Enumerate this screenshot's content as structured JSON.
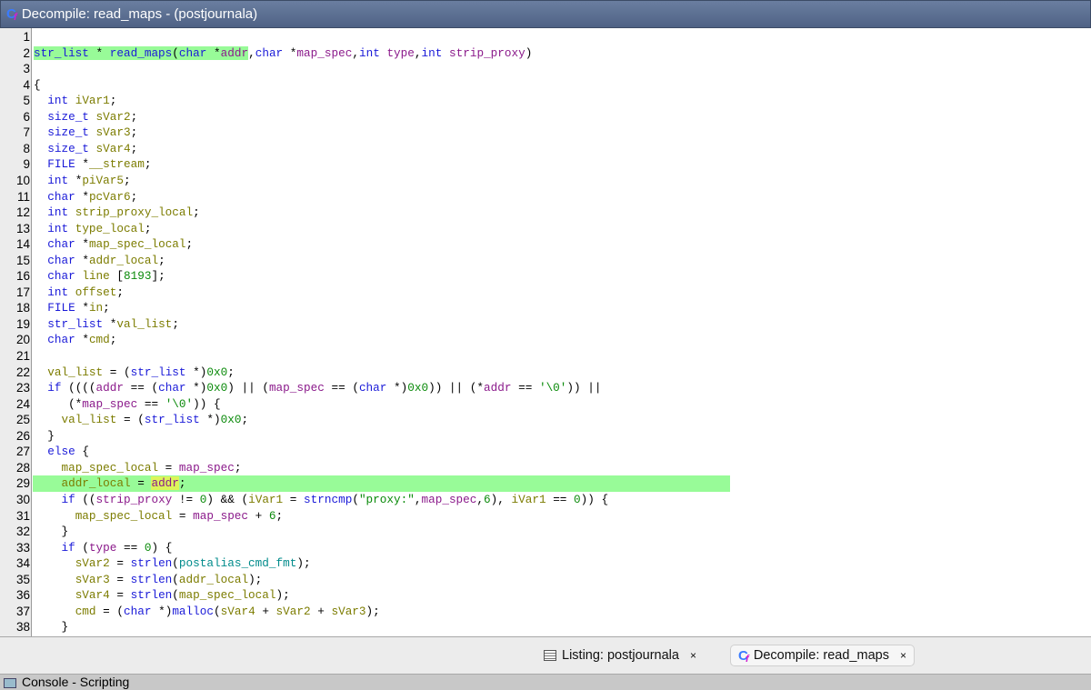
{
  "window": {
    "title": "Decompile: read_maps -  (postjournala)",
    "icon": "decompile-icon",
    "icon_text": "C"
  },
  "code": {
    "lines": [
      {
        "n": "1",
        "t": []
      },
      {
        "n": "2",
        "hl": "partial",
        "t": [
          [
            "t",
            "str_list",
            "h"
          ],
          [
            "d",
            " * ",
            "h"
          ],
          [
            "f",
            "read_maps",
            "h"
          ],
          [
            "d",
            "(",
            "h"
          ],
          [
            "k",
            "char",
            "h"
          ],
          [
            "d",
            " *",
            "h"
          ],
          [
            "p",
            "addr",
            "h"
          ],
          [
            "d",
            ","
          ],
          [
            "k",
            "char"
          ],
          [
            "d",
            " *"
          ],
          [
            "p",
            "map_spec"
          ],
          [
            "d",
            ","
          ],
          [
            "k",
            "int"
          ],
          [
            "d",
            " "
          ],
          [
            "p",
            "type"
          ],
          [
            "d",
            ","
          ],
          [
            "k",
            "int"
          ],
          [
            "d",
            " "
          ],
          [
            "p",
            "strip_proxy"
          ],
          [
            "d",
            ")"
          ]
        ]
      },
      {
        "n": "3",
        "t": []
      },
      {
        "n": "4",
        "t": [
          [
            "d",
            "{"
          ]
        ]
      },
      {
        "n": "5",
        "t": [
          [
            "d",
            "  "
          ],
          [
            "k",
            "int"
          ],
          [
            "d",
            " "
          ],
          [
            "v",
            "iVar1"
          ],
          [
            "d",
            ";"
          ]
        ]
      },
      {
        "n": "6",
        "t": [
          [
            "d",
            "  "
          ],
          [
            "k",
            "size_t"
          ],
          [
            "d",
            " "
          ],
          [
            "v",
            "sVar2"
          ],
          [
            "d",
            ";"
          ]
        ]
      },
      {
        "n": "7",
        "t": [
          [
            "d",
            "  "
          ],
          [
            "k",
            "size_t"
          ],
          [
            "d",
            " "
          ],
          [
            "v",
            "sVar3"
          ],
          [
            "d",
            ";"
          ]
        ]
      },
      {
        "n": "8",
        "t": [
          [
            "d",
            "  "
          ],
          [
            "k",
            "size_t"
          ],
          [
            "d",
            " "
          ],
          [
            "v",
            "sVar4"
          ],
          [
            "d",
            ";"
          ]
        ]
      },
      {
        "n": "9",
        "t": [
          [
            "d",
            "  "
          ],
          [
            "k",
            "FILE"
          ],
          [
            "d",
            " *"
          ],
          [
            "v",
            "__stream"
          ],
          [
            "d",
            ";"
          ]
        ]
      },
      {
        "n": "10",
        "t": [
          [
            "d",
            "  "
          ],
          [
            "k",
            "int"
          ],
          [
            "d",
            " *"
          ],
          [
            "v",
            "piVar5"
          ],
          [
            "d",
            ";"
          ]
        ]
      },
      {
        "n": "11",
        "t": [
          [
            "d",
            "  "
          ],
          [
            "k",
            "char"
          ],
          [
            "d",
            " *"
          ],
          [
            "v",
            "pcVar6"
          ],
          [
            "d",
            ";"
          ]
        ]
      },
      {
        "n": "12",
        "t": [
          [
            "d",
            "  "
          ],
          [
            "k",
            "int"
          ],
          [
            "d",
            " "
          ],
          [
            "v",
            "strip_proxy_local"
          ],
          [
            "d",
            ";"
          ]
        ]
      },
      {
        "n": "13",
        "t": [
          [
            "d",
            "  "
          ],
          [
            "k",
            "int"
          ],
          [
            "d",
            " "
          ],
          [
            "v",
            "type_local"
          ],
          [
            "d",
            ";"
          ]
        ]
      },
      {
        "n": "14",
        "t": [
          [
            "d",
            "  "
          ],
          [
            "k",
            "char"
          ],
          [
            "d",
            " *"
          ],
          [
            "v",
            "map_spec_local"
          ],
          [
            "d",
            ";"
          ]
        ]
      },
      {
        "n": "15",
        "t": [
          [
            "d",
            "  "
          ],
          [
            "k",
            "char"
          ],
          [
            "d",
            " *"
          ],
          [
            "v",
            "addr_local"
          ],
          [
            "d",
            ";"
          ]
        ]
      },
      {
        "n": "16",
        "t": [
          [
            "d",
            "  "
          ],
          [
            "k",
            "char"
          ],
          [
            "d",
            " "
          ],
          [
            "v",
            "line"
          ],
          [
            "d",
            " ["
          ],
          [
            "n",
            "8193"
          ],
          [
            "d",
            "];"
          ]
        ]
      },
      {
        "n": "17",
        "t": [
          [
            "d",
            "  "
          ],
          [
            "k",
            "int"
          ],
          [
            "d",
            " "
          ],
          [
            "v",
            "offset"
          ],
          [
            "d",
            ";"
          ]
        ]
      },
      {
        "n": "18",
        "t": [
          [
            "d",
            "  "
          ],
          [
            "k",
            "FILE"
          ],
          [
            "d",
            " *"
          ],
          [
            "v",
            "in"
          ],
          [
            "d",
            ";"
          ]
        ]
      },
      {
        "n": "19",
        "t": [
          [
            "d",
            "  "
          ],
          [
            "k",
            "str_list"
          ],
          [
            "d",
            " *"
          ],
          [
            "v",
            "val_list"
          ],
          [
            "d",
            ";"
          ]
        ]
      },
      {
        "n": "20",
        "t": [
          [
            "d",
            "  "
          ],
          [
            "k",
            "char"
          ],
          [
            "d",
            " *"
          ],
          [
            "v",
            "cmd"
          ],
          [
            "d",
            ";"
          ]
        ]
      },
      {
        "n": "21",
        "t": []
      },
      {
        "n": "22",
        "t": [
          [
            "d",
            "  "
          ],
          [
            "v",
            "val_list"
          ],
          [
            "d",
            " = ("
          ],
          [
            "k",
            "str_list"
          ],
          [
            "d",
            " *)"
          ],
          [
            "n",
            "0x0"
          ],
          [
            "d",
            ";"
          ]
        ]
      },
      {
        "n": "23",
        "t": [
          [
            "d",
            "  "
          ],
          [
            "k",
            "if"
          ],
          [
            "d",
            " (((("
          ],
          [
            "p",
            "addr"
          ],
          [
            "d",
            " == ("
          ],
          [
            "k",
            "char"
          ],
          [
            "d",
            " *)"
          ],
          [
            "n",
            "0x0"
          ],
          [
            "d",
            ") || ("
          ],
          [
            "p",
            "map_spec"
          ],
          [
            "d",
            " == ("
          ],
          [
            "k",
            "char"
          ],
          [
            "d",
            " *)"
          ],
          [
            "n",
            "0x0"
          ],
          [
            "d",
            ")) || (*"
          ],
          [
            "p",
            "addr"
          ],
          [
            "d",
            " == "
          ],
          [
            "s",
            "'\\0'"
          ],
          [
            "d",
            ")) ||"
          ]
        ]
      },
      {
        "n": "24",
        "t": [
          [
            "d",
            "     (*"
          ],
          [
            "p",
            "map_spec"
          ],
          [
            "d",
            " == "
          ],
          [
            "s",
            "'\\0'"
          ],
          [
            "d",
            ")) {"
          ]
        ]
      },
      {
        "n": "25",
        "t": [
          [
            "d",
            "    "
          ],
          [
            "v",
            "val_list"
          ],
          [
            "d",
            " = ("
          ],
          [
            "k",
            "str_list"
          ],
          [
            "d",
            " *)"
          ],
          [
            "n",
            "0x0"
          ],
          [
            "d",
            ";"
          ]
        ]
      },
      {
        "n": "26",
        "t": [
          [
            "d",
            "  }"
          ]
        ]
      },
      {
        "n": "27",
        "t": [
          [
            "d",
            "  "
          ],
          [
            "k",
            "else"
          ],
          [
            "d",
            " {"
          ]
        ]
      },
      {
        "n": "28",
        "t": [
          [
            "d",
            "    "
          ],
          [
            "v",
            "map_spec_local"
          ],
          [
            "d",
            " = "
          ],
          [
            "p",
            "map_spec"
          ],
          [
            "d",
            ";"
          ]
        ]
      },
      {
        "n": "29",
        "hl": "full",
        "t": [
          [
            "d",
            "    "
          ],
          [
            "v",
            "addr_local"
          ],
          [
            "d",
            " = "
          ],
          [
            "p",
            "addr",
            "y"
          ],
          [
            "d",
            ";"
          ]
        ]
      },
      {
        "n": "30",
        "t": [
          [
            "d",
            "    "
          ],
          [
            "k",
            "if"
          ],
          [
            "d",
            " (("
          ],
          [
            "p",
            "strip_proxy"
          ],
          [
            "d",
            " != "
          ],
          [
            "n",
            "0"
          ],
          [
            "d",
            ") && ("
          ],
          [
            "v",
            "iVar1"
          ],
          [
            "d",
            " = "
          ],
          [
            "f",
            "strncmp"
          ],
          [
            "d",
            "("
          ],
          [
            "s",
            "\"proxy:\""
          ],
          [
            "d",
            ","
          ],
          [
            "p",
            "map_spec"
          ],
          [
            "d",
            ","
          ],
          [
            "n",
            "6"
          ],
          [
            "d",
            "), "
          ],
          [
            "v",
            "iVar1"
          ],
          [
            "d",
            " == "
          ],
          [
            "n",
            "0"
          ],
          [
            "d",
            ")) {"
          ]
        ]
      },
      {
        "n": "31",
        "t": [
          [
            "d",
            "      "
          ],
          [
            "v",
            "map_spec_local"
          ],
          [
            "d",
            " = "
          ],
          [
            "p",
            "map_spec"
          ],
          [
            "d",
            " + "
          ],
          [
            "n",
            "6"
          ],
          [
            "d",
            ";"
          ]
        ]
      },
      {
        "n": "32",
        "t": [
          [
            "d",
            "    }"
          ]
        ]
      },
      {
        "n": "33",
        "t": [
          [
            "d",
            "    "
          ],
          [
            "k",
            "if"
          ],
          [
            "d",
            " ("
          ],
          [
            "p",
            "type"
          ],
          [
            "d",
            " == "
          ],
          [
            "n",
            "0"
          ],
          [
            "d",
            ") {"
          ]
        ]
      },
      {
        "n": "34",
        "t": [
          [
            "d",
            "      "
          ],
          [
            "v",
            "sVar2"
          ],
          [
            "d",
            " = "
          ],
          [
            "f",
            "strlen"
          ],
          [
            "d",
            "("
          ],
          [
            "g",
            "postalias_cmd_fmt"
          ],
          [
            "d",
            ");"
          ]
        ]
      },
      {
        "n": "35",
        "t": [
          [
            "d",
            "      "
          ],
          [
            "v",
            "sVar3"
          ],
          [
            "d",
            " = "
          ],
          [
            "f",
            "strlen"
          ],
          [
            "d",
            "("
          ],
          [
            "v",
            "addr_local"
          ],
          [
            "d",
            ");"
          ]
        ]
      },
      {
        "n": "36",
        "t": [
          [
            "d",
            "      "
          ],
          [
            "v",
            "sVar4"
          ],
          [
            "d",
            " = "
          ],
          [
            "f",
            "strlen"
          ],
          [
            "d",
            "("
          ],
          [
            "v",
            "map_spec_local"
          ],
          [
            "d",
            ");"
          ]
        ]
      },
      {
        "n": "37",
        "t": [
          [
            "d",
            "      "
          ],
          [
            "v",
            "cmd"
          ],
          [
            "d",
            " = ("
          ],
          [
            "k",
            "char"
          ],
          [
            "d",
            " *)"
          ],
          [
            "f",
            "malloc"
          ],
          [
            "d",
            "("
          ],
          [
            "v",
            "sVar4"
          ],
          [
            "d",
            " + "
          ],
          [
            "v",
            "sVar2"
          ],
          [
            "d",
            " + "
          ],
          [
            "v",
            "sVar3"
          ],
          [
            "d",
            ");"
          ]
        ]
      },
      {
        "n": "38",
        "t": [
          [
            "d",
            "    }"
          ]
        ]
      }
    ]
  },
  "tabs": [
    {
      "label": "Listing:  postjournala",
      "close": "×",
      "icon": "listing-icon"
    },
    {
      "label": "Decompile: read_maps",
      "close": "×",
      "icon": "decompile-icon",
      "icon_text": "C"
    }
  ],
  "console": {
    "label": "Console - Scripting",
    "icon": "console-icon"
  }
}
